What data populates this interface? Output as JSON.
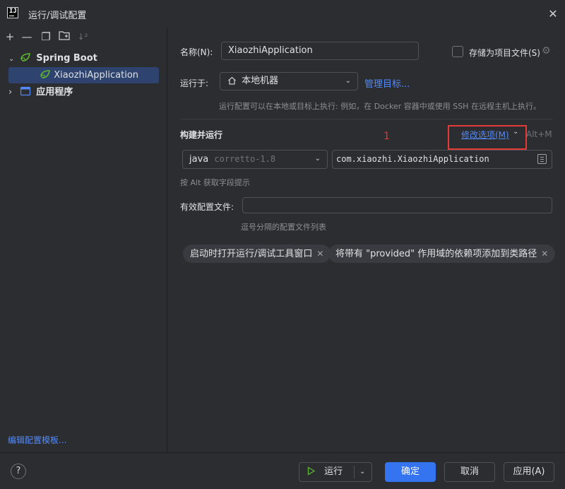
{
  "window": {
    "title": "运行/调试配置"
  },
  "toolbar": {
    "add": "+",
    "remove": "—",
    "copy": "❐",
    "folder": "▭",
    "sort": "↓²"
  },
  "tree": {
    "items": [
      {
        "label": "Spring Boot",
        "chevron": "⌄"
      },
      {
        "label": "XiaozhiApplication"
      },
      {
        "label": "应用程序",
        "chevron": "›"
      }
    ]
  },
  "sidebar": {
    "edit_templates": "编辑配置模板..."
  },
  "form": {
    "name_label": "名称(N):",
    "name_value": "XiaozhiApplication",
    "store_label": "存储为项目文件(S)",
    "run_on_label": "运行于:",
    "run_on_value": "本地机器",
    "manage_targets": "管理目标...",
    "run_on_hint": "运行配置可以在本地或目标上执行: 例如，在 Docker 容器中或使用 SSH 在远程主机上执行。",
    "build_run_title": "构建并运行",
    "modify_options": "修改选项(M)",
    "modify_shortcut": "Alt+M",
    "annotation_number": "1",
    "jdk_name": "java",
    "jdk_version": "corretto-1.8",
    "main_class": "com.xiaozhi.XiaozhiApplication",
    "alt_hint": "按 Alt 获取字段提示",
    "profiles_label": "有效配置文件:",
    "profiles_value": "",
    "profiles_hint": "逗号分隔的配置文件列表",
    "chips": [
      {
        "label": "启动时打开运行/调试工具窗口"
      },
      {
        "label": "将带有 \"provided\" 作用域的依赖项添加到类路径"
      }
    ]
  },
  "footer": {
    "help": "?",
    "run": "运行",
    "ok": "确定",
    "cancel": "取消",
    "apply": "应用(A)"
  },
  "icons": {
    "app": "intellij-icon",
    "spring": "spring-boot-icon",
    "application": "application-icon",
    "home": "home-icon",
    "play": "play-icon"
  },
  "colors": {
    "accent": "#3574f0",
    "link": "#548af7",
    "selection": "#2e436e",
    "annotation": "#e53935",
    "spring_green": "#5fb832"
  }
}
